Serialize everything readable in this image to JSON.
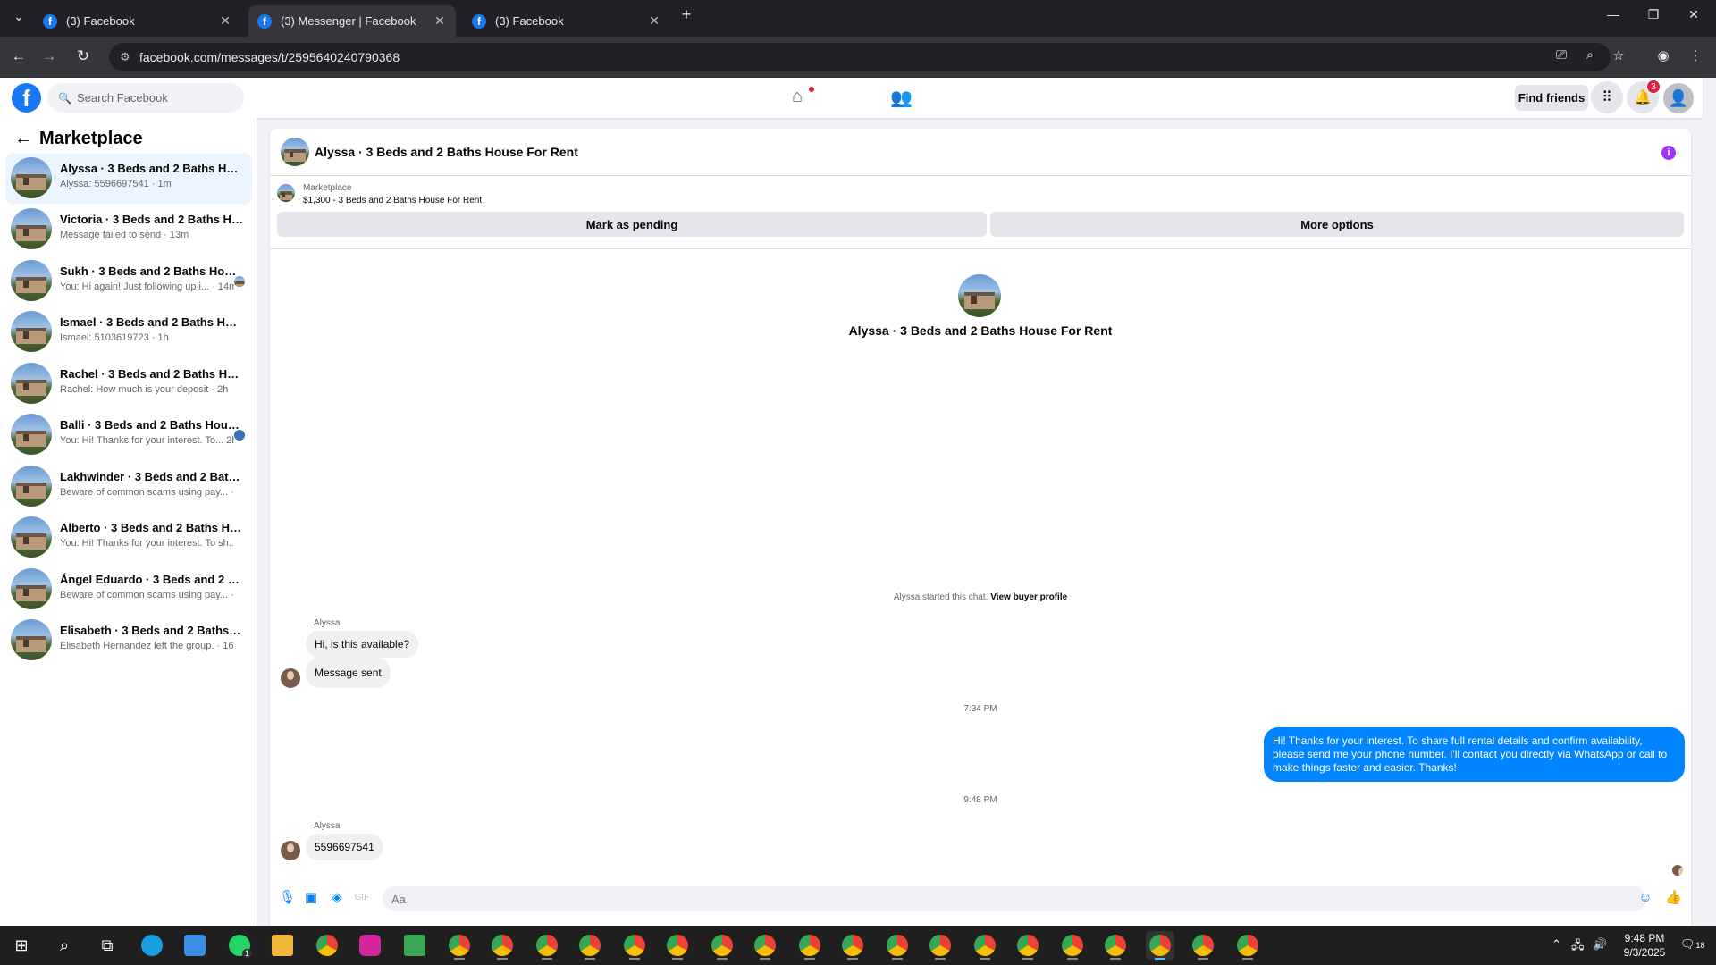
{
  "browser": {
    "tabs": [
      {
        "title": "(3) Facebook",
        "active": false
      },
      {
        "title": "(3) Messenger | Facebook",
        "active": true
      },
      {
        "title": "(3) Facebook",
        "active": false
      }
    ],
    "url": "facebook.com/messages/t/2595640240790368"
  },
  "fb": {
    "logo": "f",
    "search_placeholder": "Search Facebook",
    "find_friends": "Find friends",
    "notification_count": "3"
  },
  "sidebar": {
    "title": "Marketplace",
    "conversations": [
      {
        "name": "Alyssa · 3 Beds and 2 Baths House For Rent",
        "snippet": "Alyssa: 5596697541 · 1m",
        "active": true
      },
      {
        "name": "Victoria · 3 Beds and 2 Baths House For Rent",
        "snippet": "Message failed to send · 13m"
      },
      {
        "name": "Sukh · 3 Beds and 2 Baths House For Rent",
        "snippet": "You: Hi again! Just following up i... · 14m",
        "seen": true
      },
      {
        "name": "Ismael · 3 Beds and 2 Baths House For Rent",
        "snippet": "Ismael: 5103619723 · 1h"
      },
      {
        "name": "Rachel · 3 Beds and 2 Baths House For Rent",
        "snippet": "Rachel: How much is your deposit · 2h"
      },
      {
        "name": "Balli · 3 Beds and 2 Baths House For Rent",
        "snippet": "You: Hi! Thanks for your interest. To... 2h",
        "seen": true
      },
      {
        "name": "Lakhwinder · 3 Beds and 2 Baths House For Rent",
        "snippet": "Beware of common scams using pay... · 2h"
      },
      {
        "name": "Alberto · 3 Beds and 2 Baths House For Rent",
        "snippet": "You: Hi! Thanks for your interest. To sh... 2h"
      },
      {
        "name": "Ángel Eduardo · 3 Beds and 2 Baths House For Rent",
        "snippet": "Beware of common scams using pay... · 2h"
      },
      {
        "name": "Elisabeth · 3 Beds and 2 Baths House For Rent",
        "snippet": "Elisabeth Hernandez left the group. · 16h"
      }
    ]
  },
  "chat": {
    "title": "Alyssa · 3 Beds and 2 Baths House For Rent",
    "listing_source": "Marketplace",
    "listing_price": "$1,300 - 3 Beds and 2 Baths House For Rent",
    "mark_pending": "Mark as pending",
    "more_options": "More options",
    "intro_name": "Alyssa · 3 Beds and 2 Baths House For Rent",
    "started_text": "Alyssa started this chat.",
    "view_profile": "View buyer profile",
    "messages": {
      "sender1": "Alyssa",
      "m1": "Hi, is this available?",
      "m2": "Message sent",
      "time1": "7:34 PM",
      "out1": "Hi! Thanks for your interest. To share full rental details and confirm availability, please send me your phone number. I'll contact you directly via WhatsApp or call to make things faster and easier. Thanks!",
      "time2": "9:48 PM",
      "sender2": "Alyssa",
      "m3": "5596697541"
    },
    "composer_placeholder": "Aa"
  },
  "taskbar": {
    "time": "9:48 PM",
    "date": "9/3/2025",
    "whatsapp_badge": "1",
    "notif_count": "18"
  }
}
